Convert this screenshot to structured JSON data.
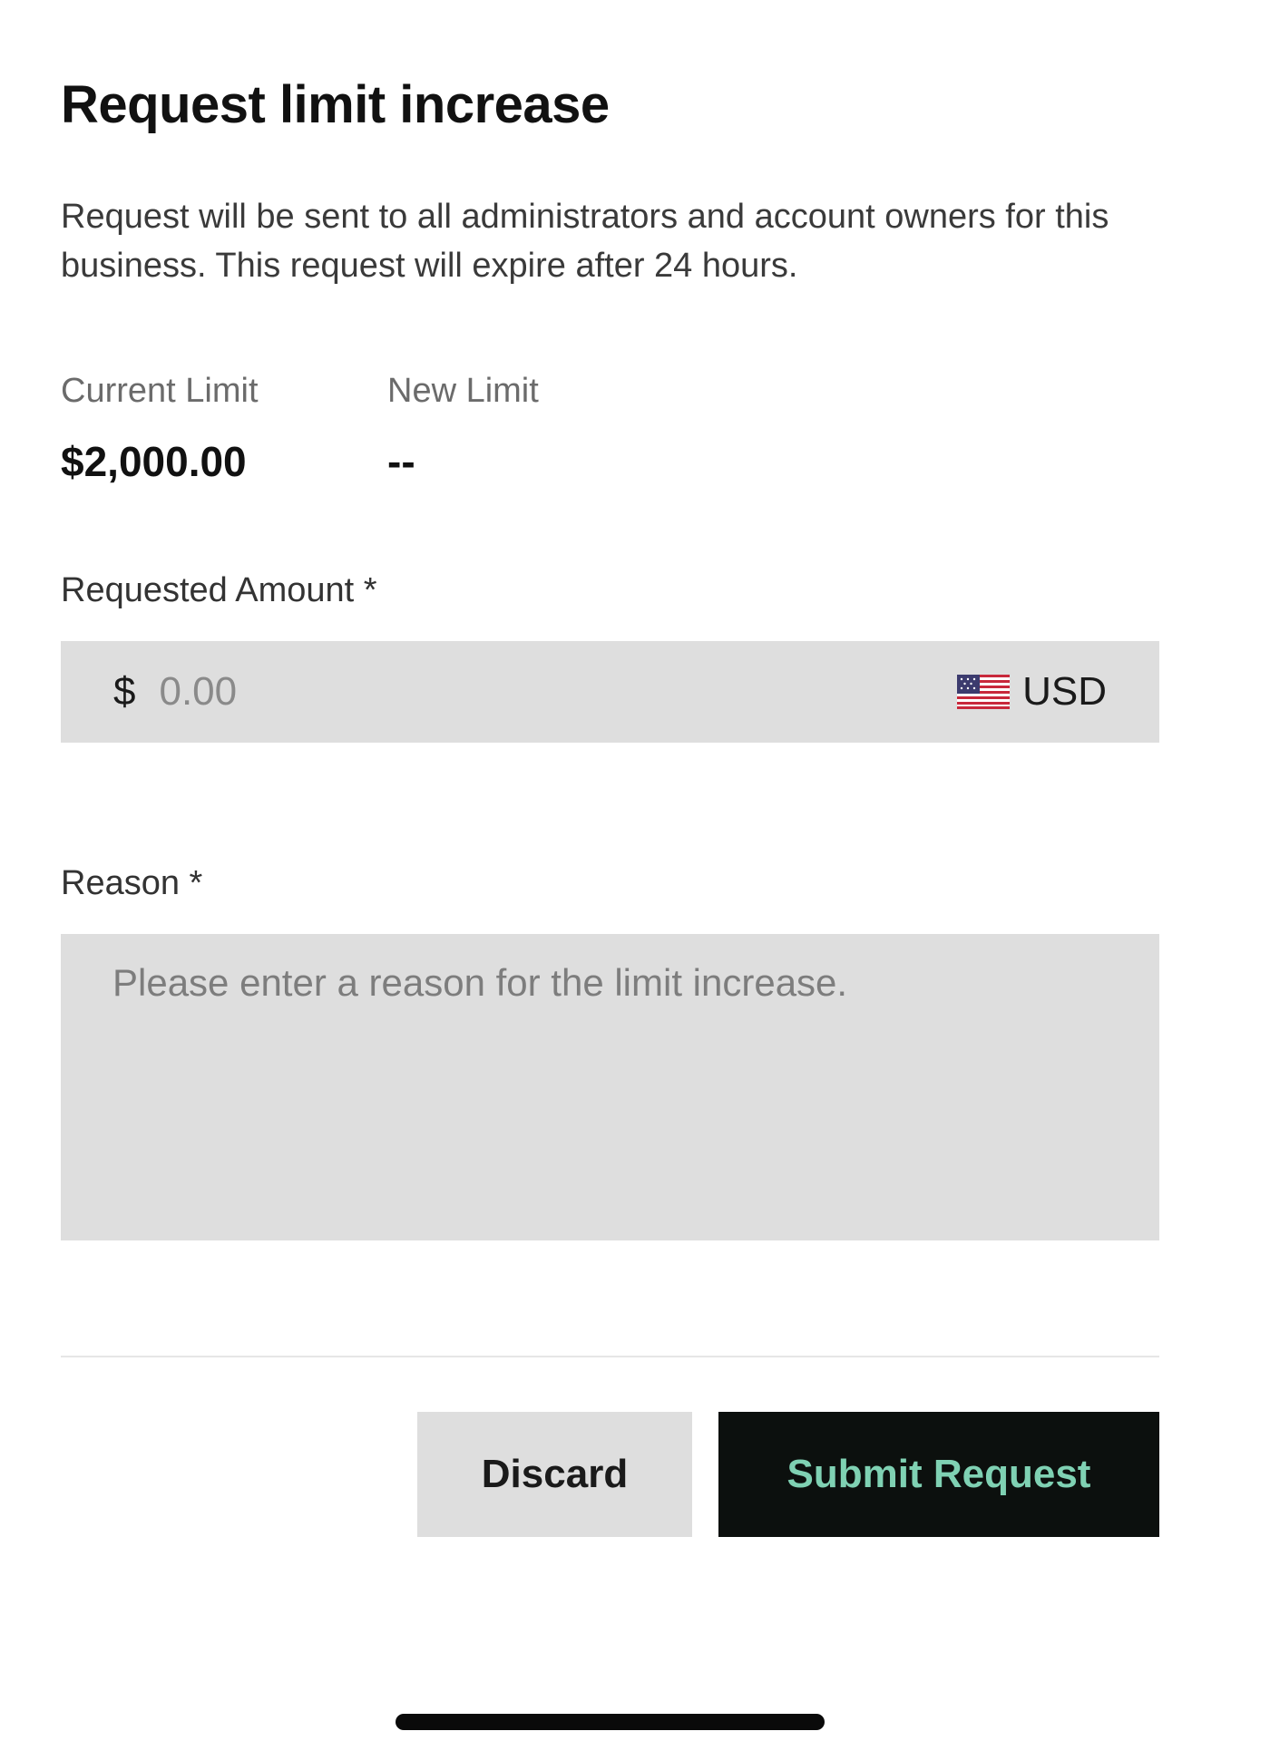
{
  "header": {
    "title": "Request limit increase",
    "description": "Request will be sent to all administrators and account owners for this business. This request will expire after 24 hours."
  },
  "limits": {
    "current_label": "Current Limit",
    "current_value": "$2,000.00",
    "new_label": "New Limit",
    "new_value": "--"
  },
  "amount": {
    "label": "Requested Amount *",
    "currency_symbol": "$",
    "placeholder": "0.00",
    "value": "",
    "currency_code": "USD",
    "currency_icon": "us-flag-icon"
  },
  "reason": {
    "label": "Reason *",
    "placeholder": "Please enter a reason for the limit increase.",
    "value": ""
  },
  "actions": {
    "discard_label": "Discard",
    "submit_label": "Submit Request"
  },
  "colors": {
    "background": "#ffffff",
    "field_background": "#dedede",
    "submit_background": "#0c100e",
    "submit_text": "#7fd1b3"
  }
}
